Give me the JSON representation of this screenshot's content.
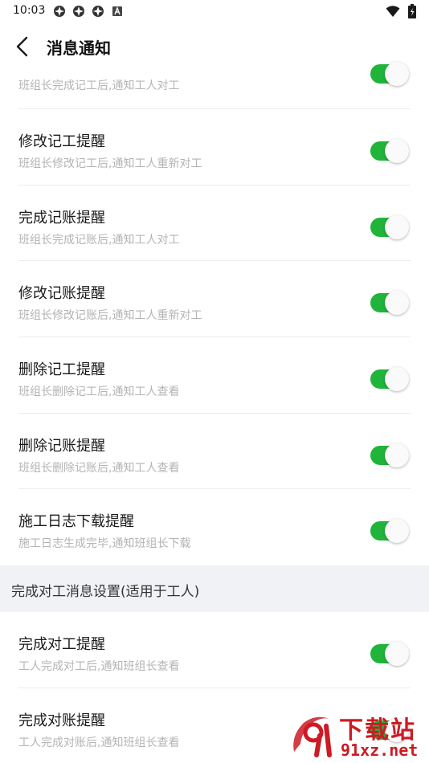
{
  "status_bar": {
    "time": "10:03",
    "left_icons": [
      "app-notification-icon",
      "app-notification-icon",
      "app-notification-icon",
      "a-badge-icon"
    ],
    "right_icons": [
      "wifi-icon",
      "battery-icon"
    ]
  },
  "nav": {
    "title": "消息通知",
    "back_icon": "chevron-left-icon"
  },
  "items_top": [
    {
      "title": "",
      "subtitle": "班组长完成记工后,通知工人对工",
      "enabled": true
    },
    {
      "title": "修改记工提醒",
      "subtitle": "班组长修改记工后,通知工人重新对工",
      "enabled": true
    },
    {
      "title": "完成记账提醒",
      "subtitle": "班组长完成记账后,通知工人对工",
      "enabled": true
    },
    {
      "title": "修改记账提醒",
      "subtitle": "班组长修改记账后,通知工人重新对工",
      "enabled": true
    },
    {
      "title": "删除记工提醒",
      "subtitle": "班组长删除记工后,通知工人查看",
      "enabled": true
    },
    {
      "title": "删除记账提醒",
      "subtitle": "班组长删除记账后,通知工人查看",
      "enabled": true
    },
    {
      "title": "施工日志下载提醒",
      "subtitle": "施工日志生成完毕,通知班组长下载",
      "enabled": true
    }
  ],
  "section": {
    "title": "完成对工消息设置(适用于工人)"
  },
  "items_bottom": [
    {
      "title": "完成对工提醒",
      "subtitle": "工人完成对工后,通知班组长查看",
      "enabled": true
    },
    {
      "title": "完成对账提醒",
      "subtitle": "工人完成对账后,通知班组长查看",
      "enabled": true
    }
  ],
  "watermark": {
    "text": "下载站",
    "url": "91xz.net"
  },
  "colors": {
    "toggle_on": "#21b43a",
    "section_bg": "#f1f2f6",
    "subtitle": "#b4b4b4",
    "watermark": "#cc1b24"
  }
}
